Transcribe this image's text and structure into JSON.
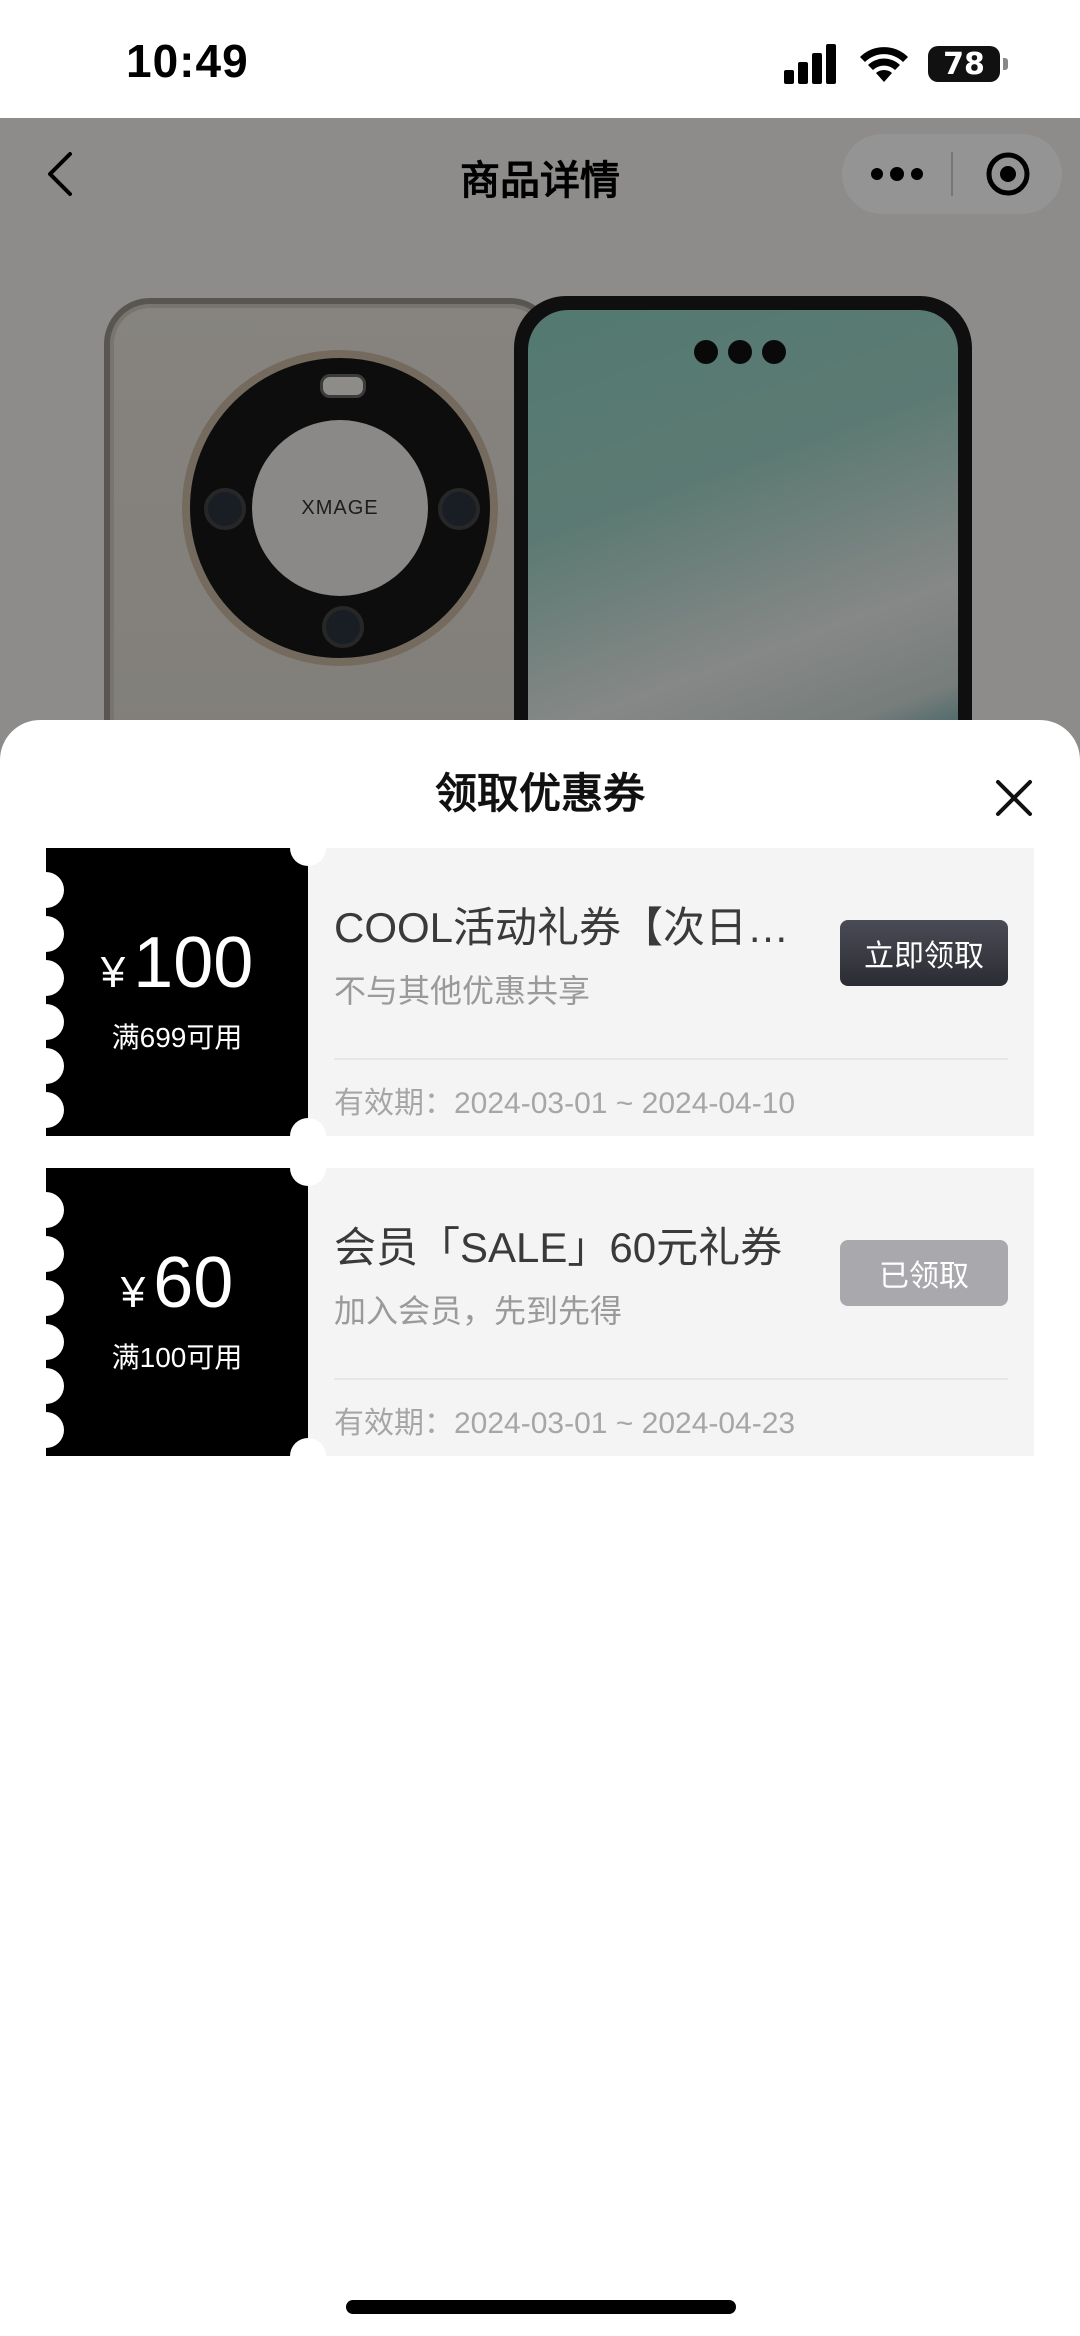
{
  "status_bar": {
    "time": "10:49",
    "battery_level": "78",
    "icons": [
      "signal-icon",
      "wifi-icon",
      "battery-icon"
    ]
  },
  "nav": {
    "title": "商品详情",
    "icons": [
      "back-arrow-icon",
      "more-dots-icon",
      "target-circle-icon"
    ]
  },
  "product_image": {
    "camera_label": "XMAGE"
  },
  "coupon_sheet": {
    "title": "领取优惠券",
    "close_icon": "close-icon",
    "coupons": [
      {
        "currency": "¥",
        "amount": "100",
        "condition": "满699可用",
        "name": "COOL活动礼券【次日…",
        "description": "不与其他优惠共享",
        "validity": "有效期：2024-03-01 ~ 2024-04-10",
        "button_label": "立即领取",
        "button_state": "active"
      },
      {
        "currency": "¥",
        "amount": "60",
        "condition": "满100可用",
        "name": "会员「SALE」60元礼券",
        "description": "加入会员，先到先得",
        "validity": "有效期：2024-03-01 ~ 2024-04-23",
        "button_label": "已领取",
        "button_state": "claimed"
      }
    ]
  },
  "colors": {
    "coupon_stub": "#000000",
    "claim_active": "#2b2c33",
    "claim_done": "#a8a8ad",
    "card_background": "#f4f4f4"
  }
}
